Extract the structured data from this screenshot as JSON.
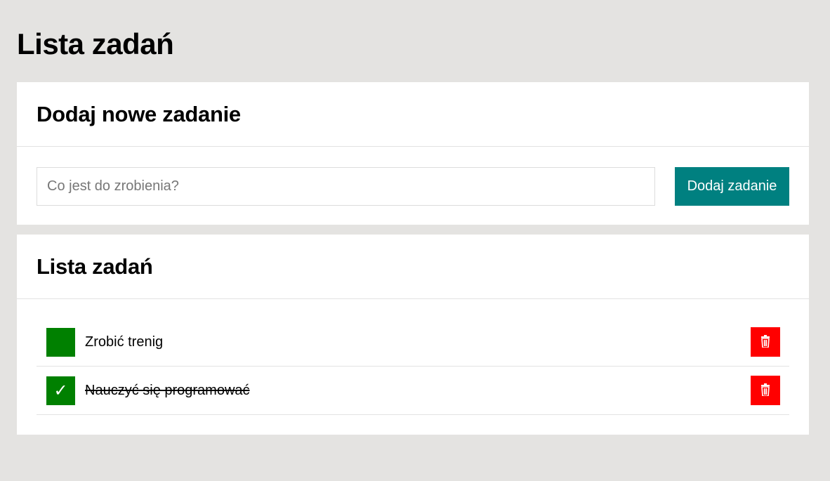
{
  "app": {
    "title": "Lista zadań"
  },
  "add_panel": {
    "title": "Dodaj nowe zadanie",
    "input_placeholder": "Co jest do zrobienia?",
    "input_value": "",
    "button_label": "Dodaj zadanie"
  },
  "list_panel": {
    "title": "Lista zadań",
    "tasks": [
      {
        "text": "Zrobić trenig",
        "done": false,
        "check_glyph": ""
      },
      {
        "text": "Nauczyć się programować",
        "done": true,
        "check_glyph": "✓"
      }
    ]
  },
  "colors": {
    "accent": "#008080",
    "checkbox": "#008000",
    "delete": "#ff0000",
    "background": "#e4e3e1"
  },
  "icons": {
    "delete": "trash-icon"
  }
}
